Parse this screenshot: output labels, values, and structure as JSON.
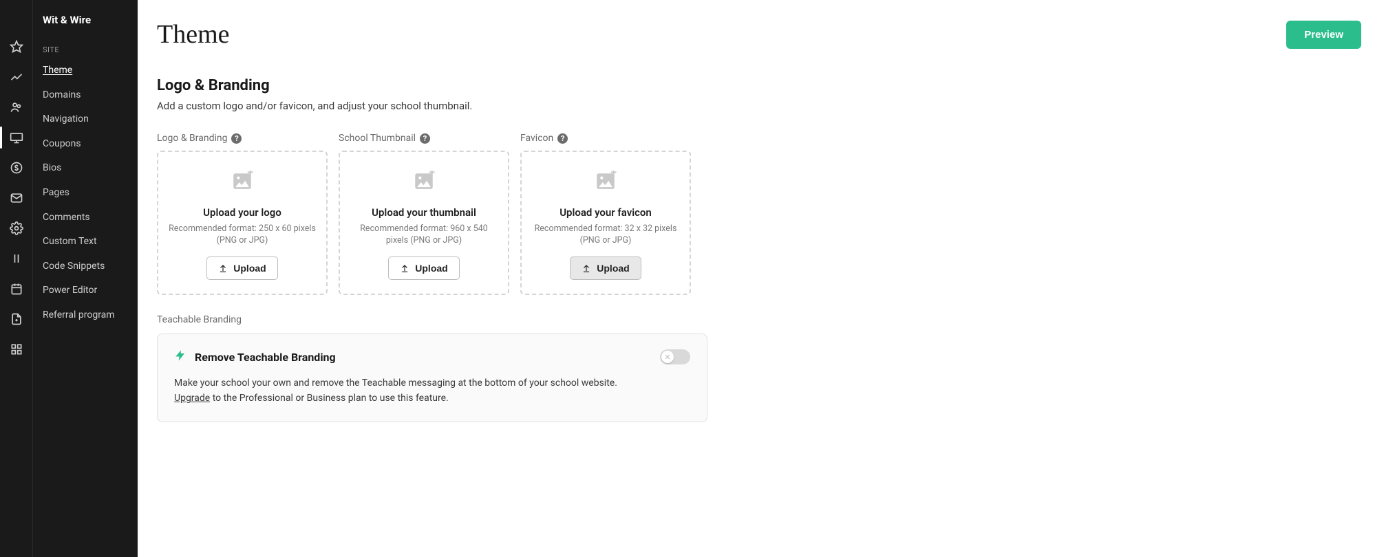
{
  "brand": "Wit & Wire",
  "sidebar": {
    "section_label": "SITE",
    "items": [
      {
        "label": "Theme",
        "active": true
      },
      {
        "label": "Domains"
      },
      {
        "label": "Navigation"
      },
      {
        "label": "Coupons"
      },
      {
        "label": "Bios"
      },
      {
        "label": "Pages"
      },
      {
        "label": "Comments"
      },
      {
        "label": "Custom Text"
      },
      {
        "label": "Code Snippets"
      },
      {
        "label": "Power Editor"
      },
      {
        "label": "Referral program"
      }
    ]
  },
  "page": {
    "title": "Theme",
    "preview_label": "Preview"
  },
  "section": {
    "heading": "Logo & Branding",
    "sub": "Add a custom logo and/or favicon, and adjust your school thumbnail."
  },
  "cards": [
    {
      "field_label": "Logo & Branding",
      "title": "Upload your logo",
      "hint": "Recommended format: 250 x 60 pixels (PNG or JPG)",
      "button": "Upload"
    },
    {
      "field_label": "School Thumbnail",
      "title": "Upload your thumbnail",
      "hint": "Recommended format: 960 x 540 pixels (PNG or JPG)",
      "button": "Upload"
    },
    {
      "field_label": "Favicon",
      "title": "Upload your favicon",
      "hint": "Recommended format: 32 x 32 pixels (PNG or JPG)",
      "button": "Upload"
    }
  ],
  "branding_panel": {
    "section_label": "Teachable Branding",
    "title": "Remove Teachable Branding",
    "desc_line1": "Make your school your own and remove the Teachable messaging at the bottom of your school website.",
    "upgrade_word": "Upgrade",
    "desc_line2_rest": " to the Professional or Business plan to use this feature."
  }
}
